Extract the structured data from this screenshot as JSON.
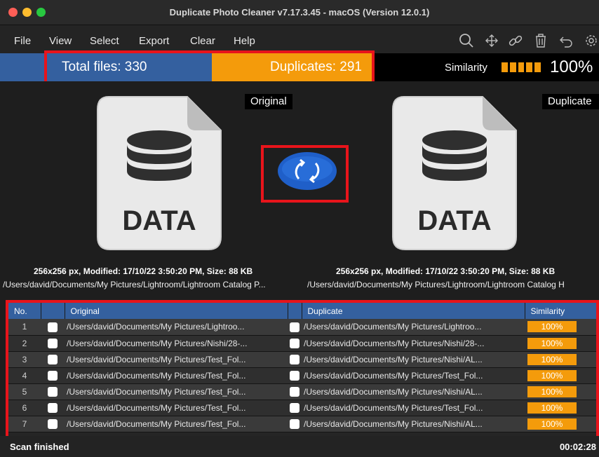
{
  "window": {
    "title": "Duplicate Photo Cleaner v7.17.3.45 - macOS (Version 12.0.1)"
  },
  "menu": {
    "items": [
      "File",
      "View",
      "Select",
      "Export",
      "Clear",
      "Help"
    ]
  },
  "toolbar": {
    "icons": [
      "search-icon",
      "move-icon",
      "link-icon",
      "trash-icon",
      "undo-icon",
      "gear-icon"
    ]
  },
  "stats": {
    "total": "Total files: 330",
    "duplicates": "Duplicates: 291",
    "similarity_label": "Similarity",
    "similarity_value": "100%",
    "similarity_level": 1.0
  },
  "preview": {
    "original_label": "Original",
    "duplicate_label": "Duplicate",
    "icon_text": "DATA",
    "original_meta": "256x256 px, Modified: 17/10/22 3:50:20 PM, Size: 88 KB",
    "duplicate_meta": "256x256 px, Modified: 17/10/22 3:50:20 PM, Size: 88 KB",
    "original_path": "/Users/david/Documents/My Pictures/Lightroom/Lightroom Catalog P...",
    "duplicate_path": "/Users/david/Documents/My Pictures/Lightroom/Lightroom Catalog H"
  },
  "table": {
    "headers": [
      "No.",
      "",
      "Original",
      "",
      "Duplicate",
      "Similarity"
    ],
    "rows": [
      {
        "no": "1",
        "original": "/Users/david/Documents/My Pictures/Lightroo...",
        "duplicate": "/Users/david/Documents/My Pictures/Lightroo...",
        "similarity": "100%"
      },
      {
        "no": "2",
        "original": "/Users/david/Documents/My Pictures/Nishi/28-...",
        "duplicate": "/Users/david/Documents/My Pictures/Nishi/28-...",
        "similarity": "100%"
      },
      {
        "no": "3",
        "original": "/Users/david/Documents/My Pictures/Test_Fol...",
        "duplicate": "/Users/david/Documents/My Pictures/Nishi/AL...",
        "similarity": "100%"
      },
      {
        "no": "4",
        "original": "/Users/david/Documents/My Pictures/Test_Fol...",
        "duplicate": "/Users/david/Documents/My Pictures/Test_Fol...",
        "similarity": "100%"
      },
      {
        "no": "5",
        "original": "/Users/david/Documents/My Pictures/Test_Fol...",
        "duplicate": "/Users/david/Documents/My Pictures/Nishi/AL...",
        "similarity": "100%"
      },
      {
        "no": "6",
        "original": "/Users/david/Documents/My Pictures/Test_Fol...",
        "duplicate": "/Users/david/Documents/My Pictures/Test_Fol...",
        "similarity": "100%"
      },
      {
        "no": "7",
        "original": "/Users/david/Documents/My Pictures/Test_Fol...",
        "duplicate": "/Users/david/Documents/My Pictures/Nishi/AL...",
        "similarity": "100%"
      }
    ]
  },
  "status": {
    "text": "Scan finished",
    "time": "00:02:28"
  },
  "colors": {
    "blue": "#34609f",
    "orange": "#f49b0b",
    "highlight": "#e8141b"
  }
}
